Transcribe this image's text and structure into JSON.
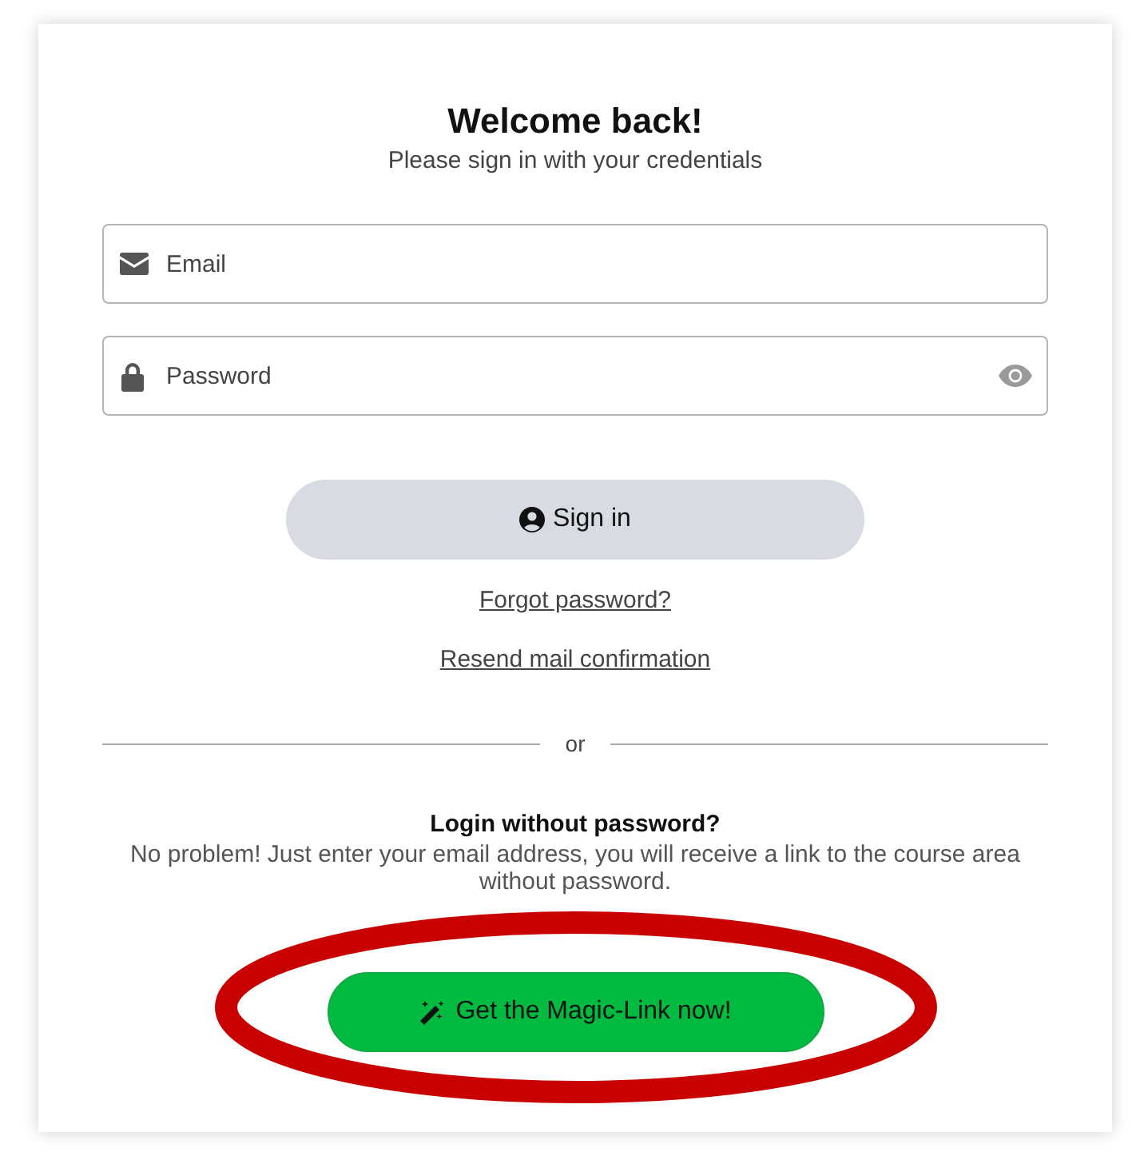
{
  "header": {
    "title": "Welcome back!",
    "subtitle": "Please sign in with your credentials"
  },
  "fields": [
    {
      "kind": "email",
      "placeholder": "Email"
    },
    {
      "kind": "password",
      "placeholder": "Password"
    }
  ],
  "sign_in_button": "Sign in",
  "links": [
    "Forgot password?",
    "Resend mail confirmation"
  ],
  "divider": "or",
  "magic_link": {
    "heading": "Login without password?",
    "text": "No problem! Just enter your email address, you will receive a link to the course area without password.",
    "button": "Get the Magic-Link now!"
  }
}
